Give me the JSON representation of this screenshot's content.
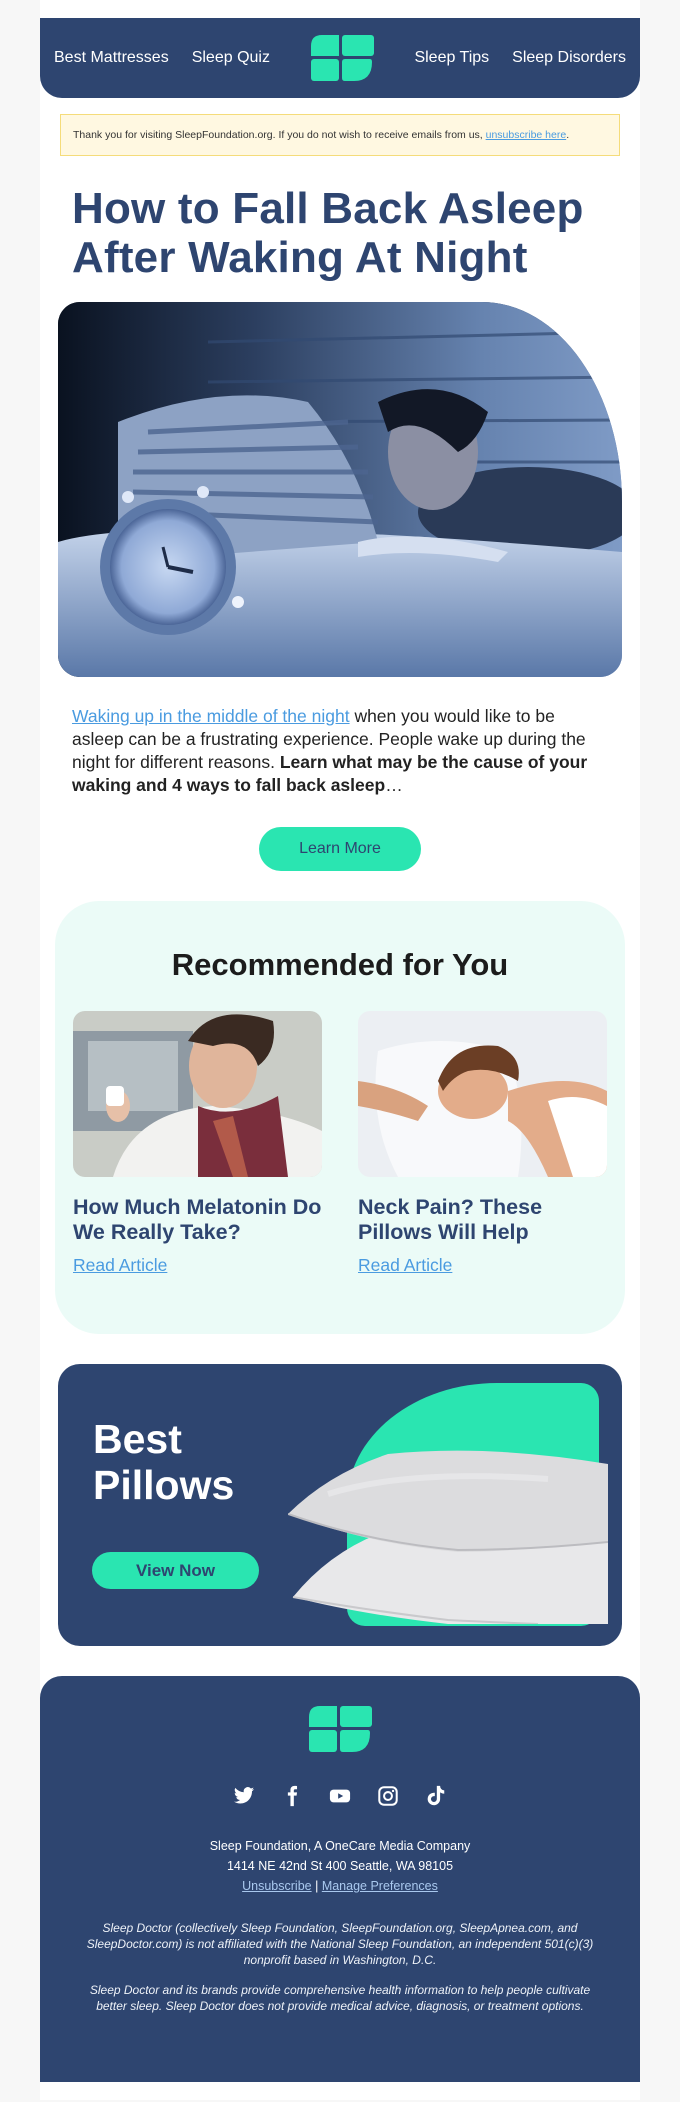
{
  "colors": {
    "navy": "#2e4570",
    "mint": "#2ae5b1",
    "link": "#4a9be0",
    "rec_bg": "#ebfbf7",
    "notice_bg": "#fff8e1"
  },
  "header": {
    "nav_left": [
      {
        "label": "Best Mattresses"
      },
      {
        "label": "Sleep Quiz"
      }
    ],
    "logo_icon": "sleep-foundation-logo",
    "nav_right": [
      {
        "label": "Sleep Tips"
      },
      {
        "label": "Sleep Disorders"
      }
    ]
  },
  "notice": {
    "text": "Thank you for visiting SleepFoundation.org. If you do not wish to receive emails from us, ",
    "link_label": "unsubscribe here",
    "suffix": "."
  },
  "article": {
    "title": "How to Fall Back Asleep After Waking At Night",
    "hero_alt": "Woman lying awake in bed next to an alarm clock at night",
    "intro_link": "Waking up in the middle of the night",
    "intro_text": " when you would like to be asleep can be a frustrating experience. People wake up during the night for different reasons. ",
    "intro_bold": "Learn what may be the cause of your waking and 4 ways to fall back asleep",
    "intro_ellipsis": "…",
    "cta_label": "Learn More"
  },
  "recommended": {
    "title": "Recommended for You",
    "cards": [
      {
        "title": "How Much Melatonin Do We Really Take?",
        "link_label": "Read Article",
        "image_alt": "Woman reading a medicine bottle"
      },
      {
        "title": "Neck Pain? These Pillows Will Help",
        "link_label": "Read Article",
        "image_alt": "Woman sleeping on a white pillow"
      }
    ]
  },
  "banner": {
    "title_line1": "Best",
    "title_line2": "Pillows",
    "cta_label": "View Now"
  },
  "footer": {
    "social": [
      {
        "name": "twitter-icon"
      },
      {
        "name": "facebook-icon"
      },
      {
        "name": "youtube-icon"
      },
      {
        "name": "instagram-icon"
      },
      {
        "name": "tiktok-icon"
      }
    ],
    "company": "Sleep Foundation, A OneCare Media Company",
    "address": "1414 NE 42nd St 400 Seattle, WA 98105",
    "unsubscribe_label": "Unsubscribe",
    "separator": " | ",
    "preferences_label": "Manage Preferences",
    "disclaimer1": "Sleep Doctor (collectively Sleep Foundation, SleepFoundation.org, SleepApnea.com, and SleepDoctor.com) is not affiliated with the National Sleep Foundation, an independent 501(c)(3) nonprofit based in Washington, D.C.",
    "disclaimer2": "Sleep Doctor and its brands provide comprehensive health information to help people cultivate better sleep. Sleep Doctor does not provide medical advice, diagnosis, or treatment options."
  }
}
